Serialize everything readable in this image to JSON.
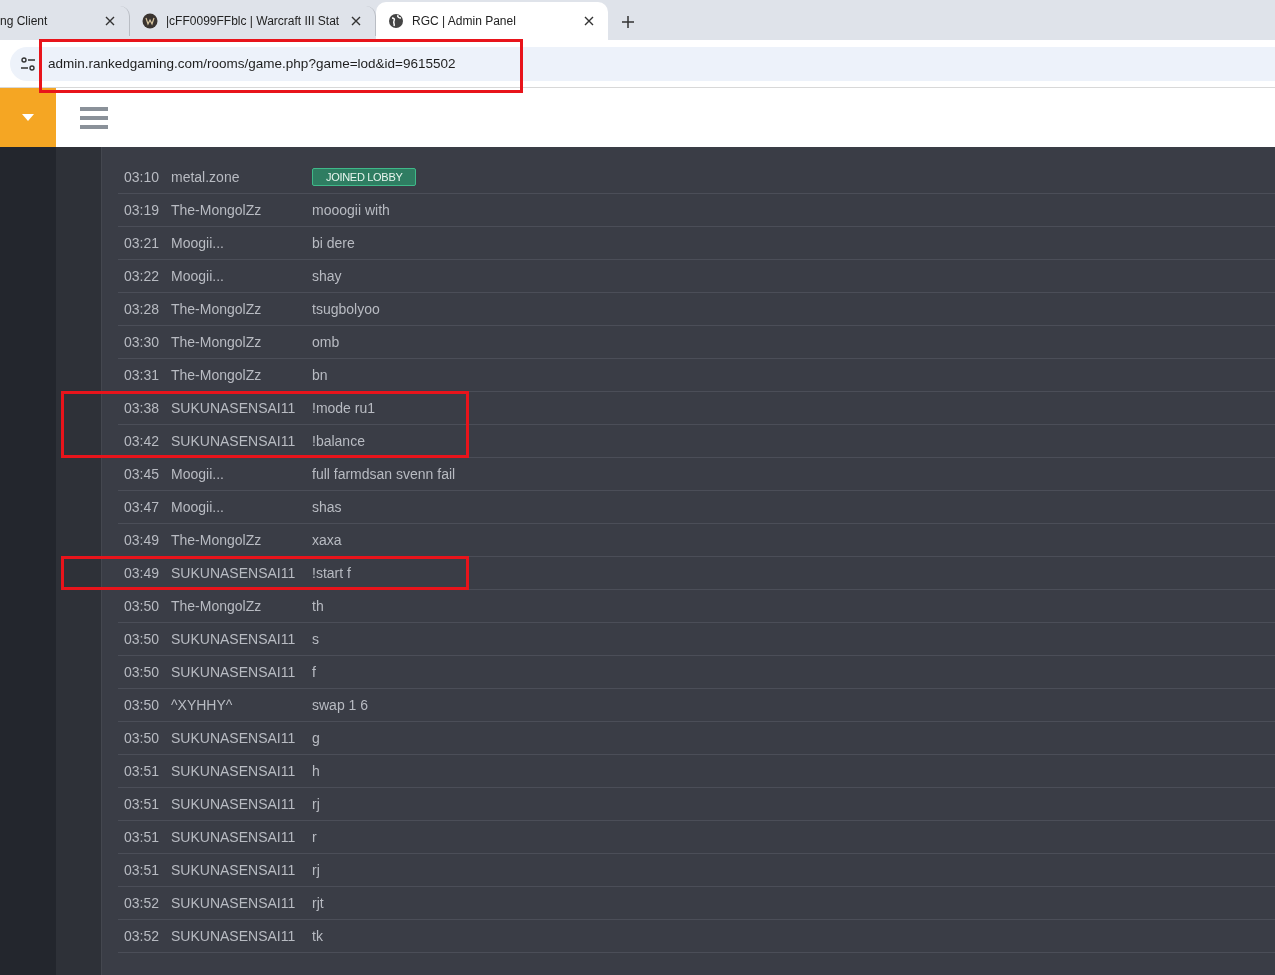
{
  "browser": {
    "tabs": [
      {
        "title": "ng Client",
        "selected": false
      },
      {
        "title": "|cFF0099FFblc | Warcraft III Stat",
        "selected": false
      },
      {
        "title": "RGC | Admin Panel",
        "selected": true
      }
    ],
    "address": {
      "url": "admin.rankedgaming.com/rooms/game.php?game=lod&id=9615502",
      "highlighted": true
    }
  },
  "chat_log": [
    {
      "time": "03:10",
      "player": "metal.zone",
      "kind": "event",
      "text": "JOINED LOBBY",
      "highlighted": false
    },
    {
      "time": "03:19",
      "player": "The-MongolZz",
      "kind": "message",
      "text": "mooogii with",
      "highlighted": false
    },
    {
      "time": "03:21",
      "player": "Moogii...",
      "kind": "message",
      "text": "bi dere",
      "highlighted": false
    },
    {
      "time": "03:22",
      "player": "Moogii...",
      "kind": "message",
      "text": "shay",
      "highlighted": false
    },
    {
      "time": "03:28",
      "player": "The-MongolZz",
      "kind": "message",
      "text": "tsugbolyoo",
      "highlighted": false
    },
    {
      "time": "03:30",
      "player": "The-MongolZz",
      "kind": "message",
      "text": "omb",
      "highlighted": false
    },
    {
      "time": "03:31",
      "player": "The-MongolZz",
      "kind": "message",
      "text": "bn",
      "highlighted": false
    },
    {
      "time": "03:38",
      "player": "SUKUNASENSAI11",
      "kind": "message",
      "text": "!mode ru1",
      "highlighted": true
    },
    {
      "time": "03:42",
      "player": "SUKUNASENSAI11",
      "kind": "message",
      "text": "!balance",
      "highlighted": true
    },
    {
      "time": "03:45",
      "player": "Moogii...",
      "kind": "message",
      "text": "full farmdsan svenn fail",
      "highlighted": false
    },
    {
      "time": "03:47",
      "player": "Moogii...",
      "kind": "message",
      "text": "shas",
      "highlighted": false
    },
    {
      "time": "03:49",
      "player": "The-MongolZz",
      "kind": "message",
      "text": "xaxa",
      "highlighted": false
    },
    {
      "time": "03:49",
      "player": "SUKUNASENSAI11",
      "kind": "message",
      "text": "!start f",
      "highlighted": true
    },
    {
      "time": "03:50",
      "player": "The-MongolZz",
      "kind": "message",
      "text": "th",
      "highlighted": false
    },
    {
      "time": "03:50",
      "player": "SUKUNASENSAI11",
      "kind": "message",
      "text": "s",
      "highlighted": false
    },
    {
      "time": "03:50",
      "player": "SUKUNASENSAI11",
      "kind": "message",
      "text": "f",
      "highlighted": false
    },
    {
      "time": "03:50",
      "player": "^XYHHY^",
      "kind": "message",
      "text": "swap 1 6",
      "highlighted": false
    },
    {
      "time": "03:50",
      "player": "SUKUNASENSAI11",
      "kind": "message",
      "text": "g",
      "highlighted": false
    },
    {
      "time": "03:51",
      "player": "SUKUNASENSAI11",
      "kind": "message",
      "text": "h",
      "highlighted": false
    },
    {
      "time": "03:51",
      "player": "SUKUNASENSAI11",
      "kind": "message",
      "text": "rj",
      "highlighted": false
    },
    {
      "time": "03:51",
      "player": "SUKUNASENSAI11",
      "kind": "message",
      "text": "r",
      "highlighted": false
    },
    {
      "time": "03:51",
      "player": "SUKUNASENSAI11",
      "kind": "message",
      "text": "rj",
      "highlighted": false
    },
    {
      "time": "03:52",
      "player": "SUKUNASENSAI11",
      "kind": "message",
      "text": "rjt",
      "highlighted": false
    },
    {
      "time": "03:52",
      "player": "SUKUNASENSAI11",
      "kind": "message",
      "text": "tk",
      "highlighted": false
    }
  ]
}
